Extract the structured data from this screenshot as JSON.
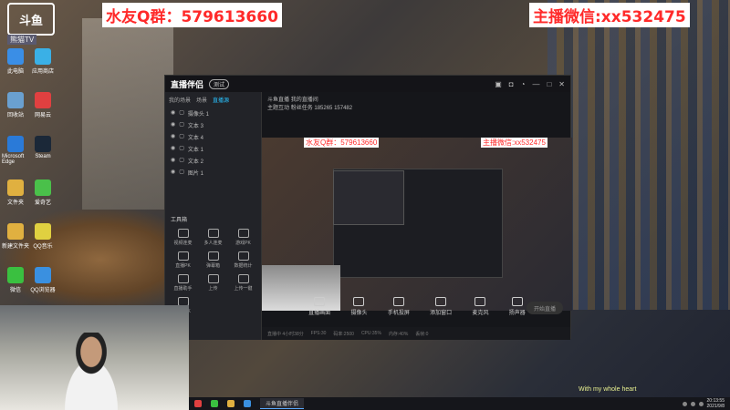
{
  "overlays": {
    "qq_group": "水友Q群：579613660",
    "wechat": "主播微信:xx532475",
    "song": "With my whole heart"
  },
  "logo": {
    "text": "斗鱼",
    "sub": "熊猫TV"
  },
  "desktop": {
    "icons": [
      {
        "label": "此电脑",
        "color": "#3a8ee6"
      },
      {
        "label": "应用商店",
        "color": "#3ab0e6"
      },
      {
        "label": "回收站",
        "color": "#6aa0d0"
      },
      {
        "label": "网易云",
        "color": "#e04040"
      },
      {
        "label": "Microsoft Edge",
        "color": "#2a7ad8"
      },
      {
        "label": "Steam",
        "color": "#1b2838"
      },
      {
        "label": "文件夹",
        "color": "#e0b040"
      },
      {
        "label": "爱奇艺",
        "color": "#4ac04a"
      },
      {
        "label": "新建文件夹",
        "color": "#e0b040"
      },
      {
        "label": "QQ音乐",
        "color": "#e0d040"
      },
      {
        "label": "微信",
        "color": "#3ac040"
      },
      {
        "label": "QQ浏览器",
        "color": "#3a90e0"
      },
      {
        "label": "Microsoft Edge",
        "color": "#2a7ad8"
      }
    ]
  },
  "app": {
    "brand": "直播伴侣",
    "pill": "测试",
    "side_tabs": [
      "我的场景",
      "场景",
      "直播源"
    ],
    "sources": [
      "摄像头 1",
      "文本 3",
      "文本 4",
      "文本 1",
      "文本 2",
      "图片 1"
    ],
    "tools_header": "工具箱",
    "tools": [
      "视频连麦",
      "多人连麦",
      "游戏PK",
      "直播PK",
      "弹幕箱",
      "数据统计",
      "直播助手",
      "上传",
      "上传一键",
      "视频PK"
    ],
    "header_title": "斗鱼直播",
    "header_sub": "我的直播间",
    "header_tags": [
      "主题互动",
      "粉丝任务",
      "185265",
      "157482"
    ],
    "preview_qq": "水友Q群：579613660",
    "preview_wechat": "主播微信:xx532475",
    "bottom_bar": [
      "直播画面",
      "摄像头",
      "手机投屏",
      "添加窗口",
      "麦克风",
      "扬声器"
    ],
    "start_label": "开始直播",
    "status": [
      "直播中 4小时38分",
      "FPS:30",
      "码率:2500",
      "CPU:35%",
      "内存:40%",
      "丢帧:0"
    ]
  },
  "taskbar": {
    "active_task": "斗鱼直播伴侣",
    "time": "20:13:55",
    "date": "2021/9/8"
  }
}
